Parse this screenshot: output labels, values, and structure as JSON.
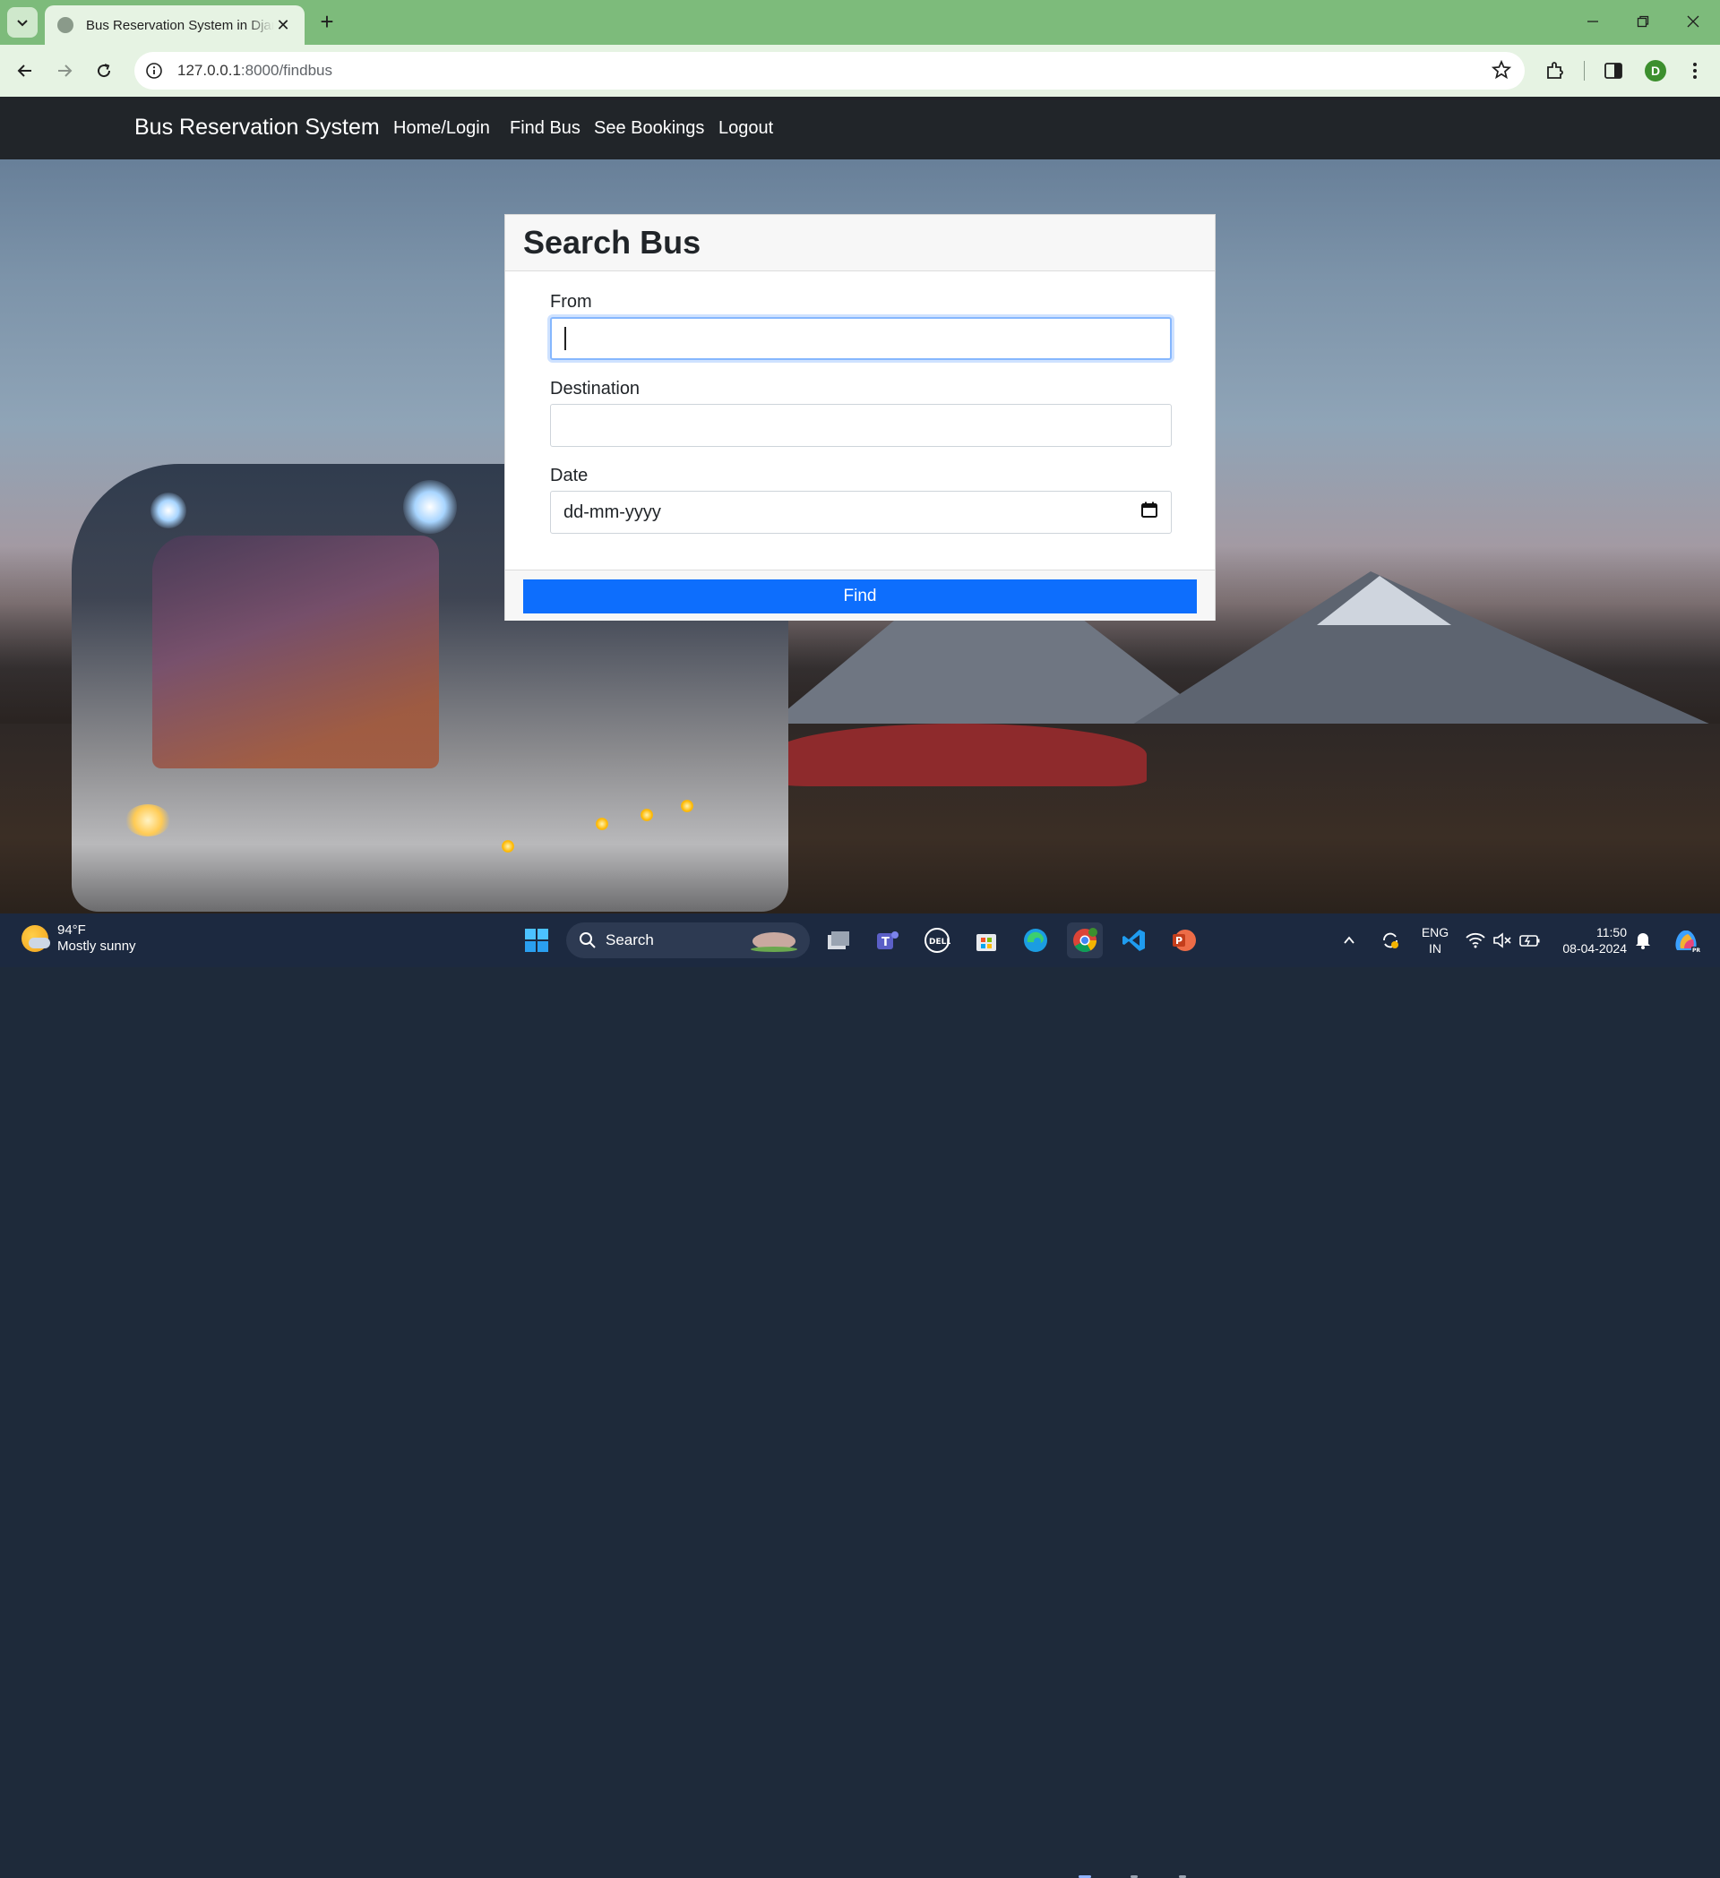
{
  "browser": {
    "tab_title": "Bus Reservation System in Djan",
    "url_host": "127.0.0.1",
    "url_path": ":8000/findbus",
    "profile_initial": "D"
  },
  "navbar": {
    "brand": "Bus Reservation System",
    "links": [
      "Home/Login",
      "Find Bus",
      "See Bookings",
      "Logout"
    ]
  },
  "card": {
    "title": "Search Bus",
    "from_label": "From",
    "from_value": "",
    "destination_label": "Destination",
    "destination_value": "",
    "date_label": "Date",
    "date_placeholder": "dd-mm-yyyy",
    "find_label": "Find"
  },
  "taskbar": {
    "temperature": "94°F",
    "weather": "Mostly sunny",
    "search_label": "Search",
    "lang_line1": "ENG",
    "lang_line2": "IN",
    "time": "11:50",
    "date": "08-04-2024"
  },
  "colors": {
    "tabbar": "#7dbb7b",
    "toolbar": "#e6f3e3",
    "navbar": "#212529",
    "primary_button": "#0d6efd",
    "taskbar": "#1c2940"
  }
}
